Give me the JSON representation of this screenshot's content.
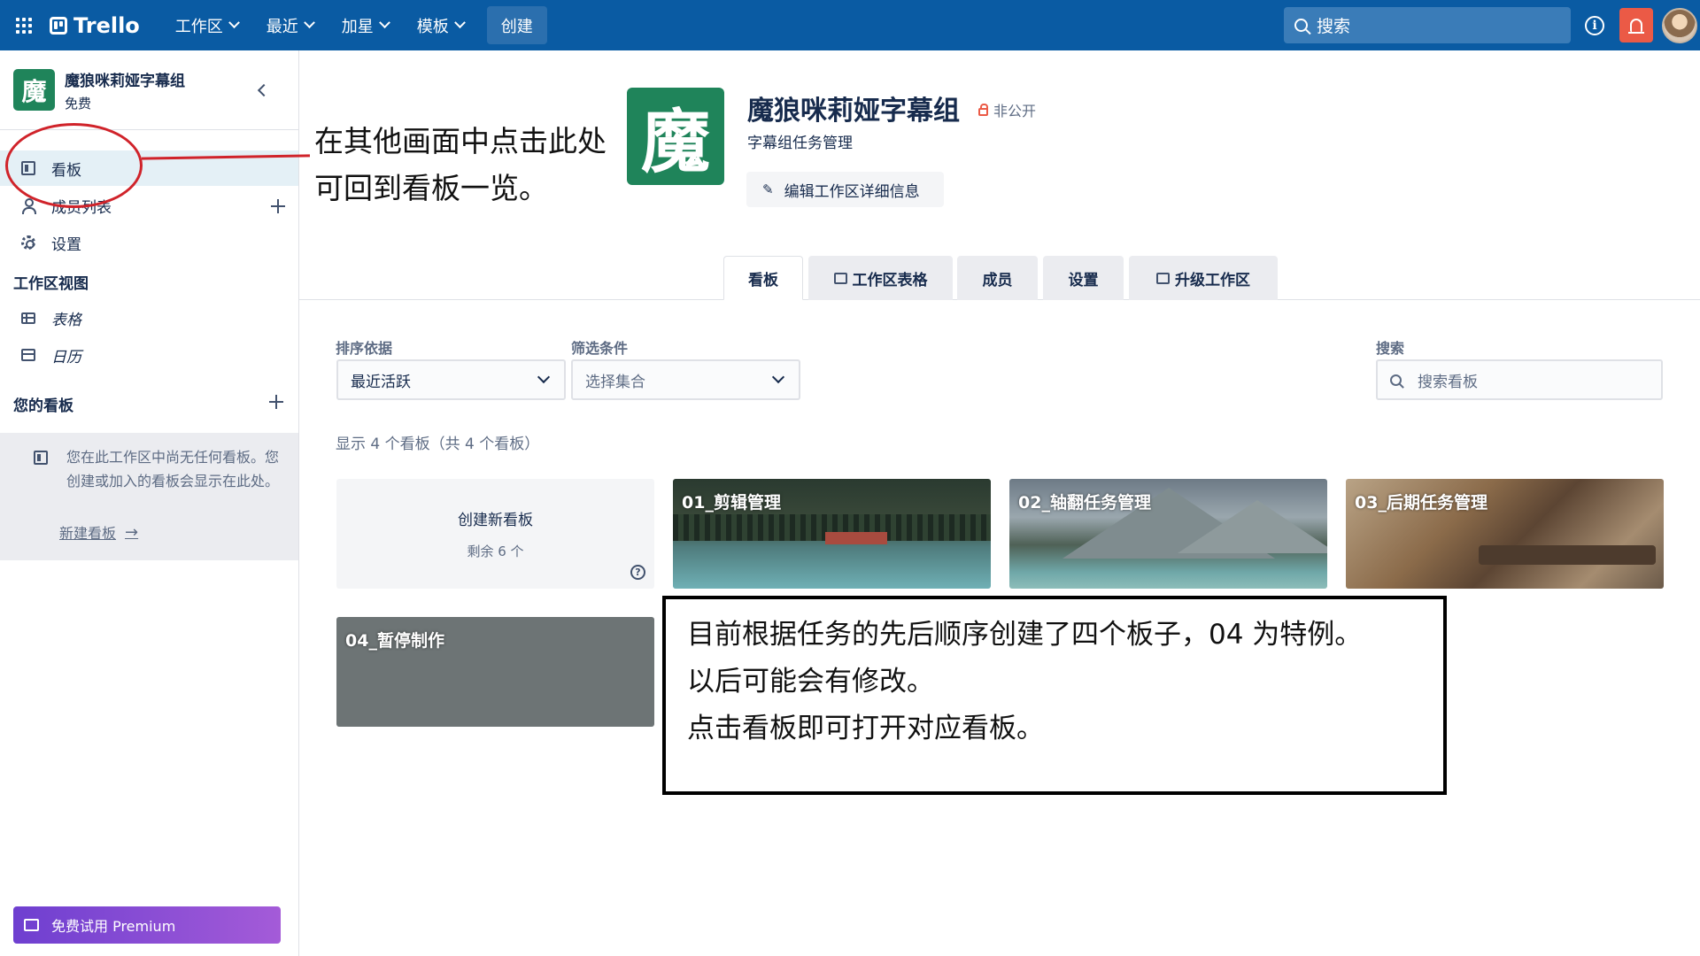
{
  "topbar": {
    "logo": "Trello",
    "nav": [
      "工作区",
      "最近",
      "加星",
      "模板"
    ],
    "create": "创建",
    "search_placeholder": "搜索",
    "accent_color": "#0a5ba3",
    "bell_color": "#eb5a46"
  },
  "sidebar": {
    "workspace_initial": "魔",
    "workspace_name": "魔狼咪莉娅字幕组",
    "workspace_plan": "免费",
    "items": [
      {
        "label": "看板",
        "icon": "board-icon"
      },
      {
        "label": "成员列表",
        "icon": "person-icon"
      },
      {
        "label": "设置",
        "icon": "gear-icon"
      }
    ],
    "views_heading": "工作区视图",
    "views": [
      {
        "label": "表格",
        "icon": "table-icon"
      },
      {
        "label": "日历",
        "icon": "calendar-icon"
      }
    ],
    "boards_heading": "您的看板",
    "empty_text": "您在此工作区中尚无任何看板。您创建或加入的看板会显示在此处。",
    "new_board_link": "新建看板",
    "arrow": "→",
    "premium_label": "免费试用 Premium"
  },
  "annotations": {
    "top_line1": "在其他画面中点击此处",
    "top_line2": "可回到看板一览。",
    "box_line1": "目前根据任务的先后顺序创建了四个板子，04 为特例。",
    "box_line2": "以后可能会有修改。",
    "box_line3": "点击看板即可打开对应看板。"
  },
  "workspace": {
    "logo_char": "魔",
    "title": "魔狼咪莉娅字幕组",
    "visibility": "非公开",
    "description": "字幕组任务管理",
    "edit_button": "编辑工作区详细信息",
    "logo_color": "#1f845a"
  },
  "tabs": [
    "看板",
    "工作区表格",
    "成员",
    "设置",
    "升级工作区"
  ],
  "filters": {
    "sort_label": "排序依据",
    "sort_value": "最近活跃",
    "filter_label": "筛选条件",
    "filter_placeholder": "选择集合",
    "search_label": "搜索",
    "search_placeholder": "搜索看板"
  },
  "count_text": "显示 4 个看板（共 4 个看板）",
  "new_board_tile": {
    "title": "创建新看板",
    "remaining": "剩余 6 个",
    "help": "?"
  },
  "boards": [
    {
      "title": "01_剪辑管理"
    },
    {
      "title": "02_轴翻任务管理"
    },
    {
      "title": "03_后期任务管理"
    },
    {
      "title": "04_暂停制作"
    }
  ]
}
